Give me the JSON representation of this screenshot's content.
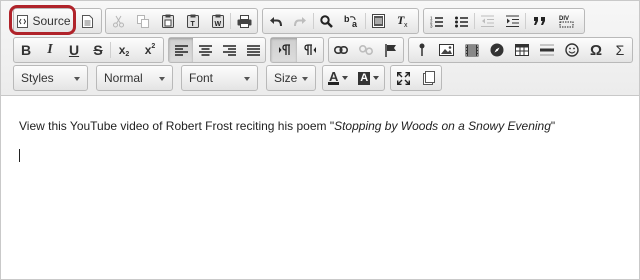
{
  "toolbar": {
    "source_label": "Source",
    "row1_icons": [
      "document-icon",
      "cut-icon",
      "copy-icon",
      "paste-icon",
      "paste-text-icon",
      "paste-word-icon",
      "print-icon",
      "undo-icon",
      "redo-icon",
      "find-icon",
      "replace-icon",
      "select-all-icon",
      "remove-format-icon",
      "numbered-list-icon",
      "bulleted-list-icon",
      "outdent-icon",
      "indent-icon",
      "blockquote-icon",
      "div-icon"
    ],
    "format": {
      "bold": "B",
      "italic": "I",
      "underline": "U",
      "strike": "S",
      "subscript_base": "x",
      "subscript_mark": "2",
      "superscript_base": "x",
      "superscript_mark": "2"
    },
    "omega": "Ω",
    "sigma": "Σ",
    "styles_combo": "Styles",
    "format_combo": "Normal",
    "font_combo": "Font",
    "size_combo": "Size",
    "text_color_letter": "A",
    "bg_color_letter": "A"
  },
  "content": {
    "text_before": "View this YouTube video of Robert Frost reciting his poem \"",
    "poem_title": "Stopping by Woods on a Snowy Evening",
    "text_after": "\""
  },
  "colors": {
    "highlight": "#b0232a",
    "toolbar_bg": "#ececec"
  }
}
